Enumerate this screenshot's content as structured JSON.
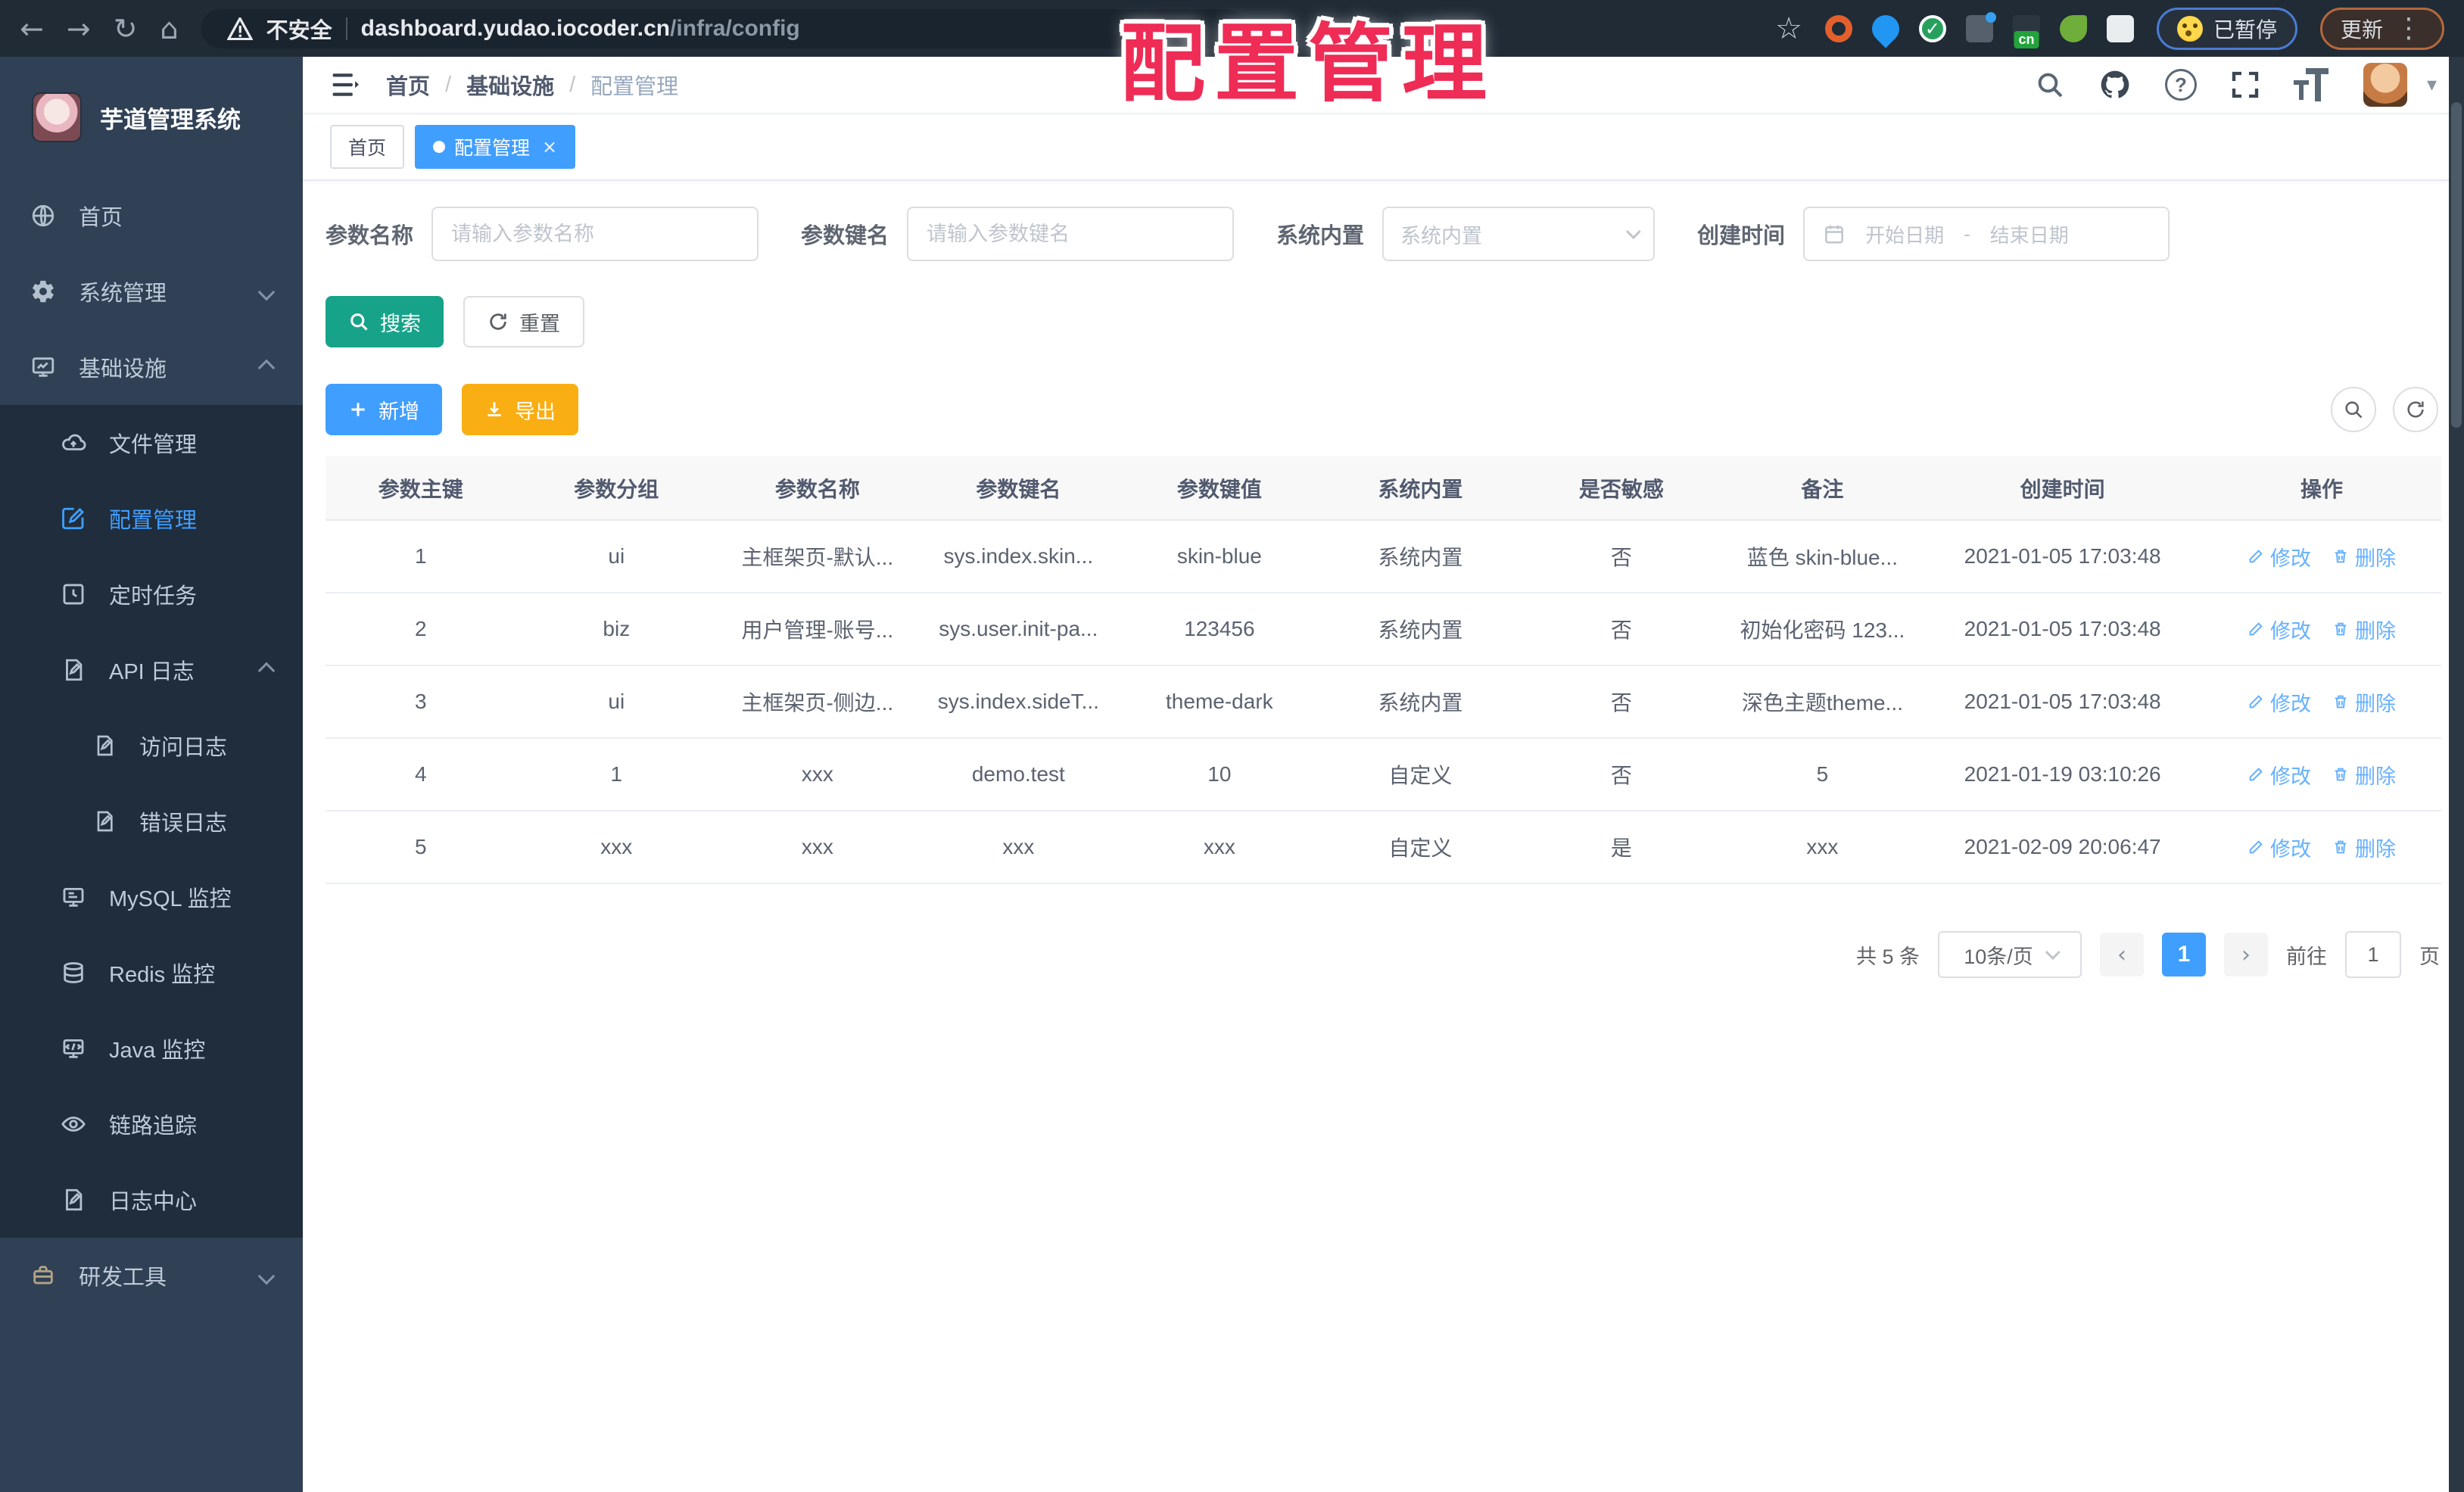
{
  "browser": {
    "security_label": "不安全",
    "url_host": "dashboard.yudao.iocoder.cn",
    "url_path": "/infra/config",
    "paused_label": "已暂停",
    "update_label": "更新"
  },
  "watermark": "配置管理",
  "icons": {
    "back": "←",
    "forward": "→",
    "reload": "↻",
    "home": "⌂",
    "star": "☆",
    "dots": "⋮",
    "check": "✓",
    "cn": "cn",
    "close": "×",
    "caret": "▾",
    "question": "?",
    "prev": "‹",
    "next": "›"
  },
  "sidebar": {
    "app_title": "芋道管理系统",
    "items": {
      "home": "首页",
      "system": "系统管理",
      "infra": "基础设施",
      "file": "文件管理",
      "config": "配置管理",
      "job": "定时任务",
      "api_log": "API 日志",
      "access_log": "访问日志",
      "error_log": "错误日志",
      "mysql": "MySQL 监控",
      "redis": "Redis 监控",
      "java": "Java 监控",
      "trace": "链路追踪",
      "log_center": "日志中心",
      "dev_tools": "研发工具"
    }
  },
  "header": {
    "breadcrumb": [
      "首页",
      "基础设施",
      "配置管理"
    ],
    "separator": "/"
  },
  "tabs": [
    {
      "label": "首页"
    },
    {
      "label": "配置管理"
    }
  ],
  "filters": {
    "name_label": "参数名称",
    "name_placeholder": "请输入参数名称",
    "key_label": "参数键名",
    "key_placeholder": "请输入参数键名",
    "type_label": "系统内置",
    "type_placeholder": "系统内置",
    "date_label": "创建时间",
    "date_start_placeholder": "开始日期",
    "date_separator": "-",
    "date_end_placeholder": "结束日期",
    "search_label": "搜索",
    "reset_label": "重置"
  },
  "toolbar": {
    "add_label": "新增",
    "export_label": "导出"
  },
  "table": {
    "columns": [
      "参数主键",
      "参数分组",
      "参数名称",
      "参数键名",
      "参数键值",
      "系统内置",
      "是否敏感",
      "备注",
      "创建时间",
      "操作"
    ],
    "edit_label": "修改",
    "delete_label": "删除",
    "rows": [
      [
        "1",
        "ui",
        "主框架页-默认...",
        "sys.index.skin...",
        "skin-blue",
        "系统内置",
        "否",
        "蓝色 skin-blue...",
        "2021-01-05 17:03:48"
      ],
      [
        "2",
        "biz",
        "用户管理-账号...",
        "sys.user.init-pa...",
        "123456",
        "系统内置",
        "否",
        "初始化密码 123...",
        "2021-01-05 17:03:48"
      ],
      [
        "3",
        "ui",
        "主框架页-侧边...",
        "sys.index.sideT...",
        "theme-dark",
        "系统内置",
        "否",
        "深色主题theme...",
        "2021-01-05 17:03:48"
      ],
      [
        "4",
        "1",
        "xxx",
        "demo.test",
        "10",
        "自定义",
        "否",
        "5",
        "2021-01-19 03:10:26"
      ],
      [
        "5",
        "xxx",
        "xxx",
        "xxx",
        "xxx",
        "自定义",
        "是",
        "xxx",
        "2021-02-09 20:06:47"
      ]
    ]
  },
  "pagination": {
    "total_label": "共 5 条",
    "page_size": "10条/页",
    "current_page": "1",
    "goto_label": "前往",
    "goto_value": "1",
    "page_unit": "页"
  },
  "colors": {
    "accent_blue": "#409eff",
    "search_teal": "#17a389",
    "export_amber": "#f9ae13",
    "watermark_red": "#ee2c55",
    "sidebar_bg": "#304156",
    "submenu_bg": "#1f2d3d",
    "active_tab_bg": "#409eff"
  }
}
